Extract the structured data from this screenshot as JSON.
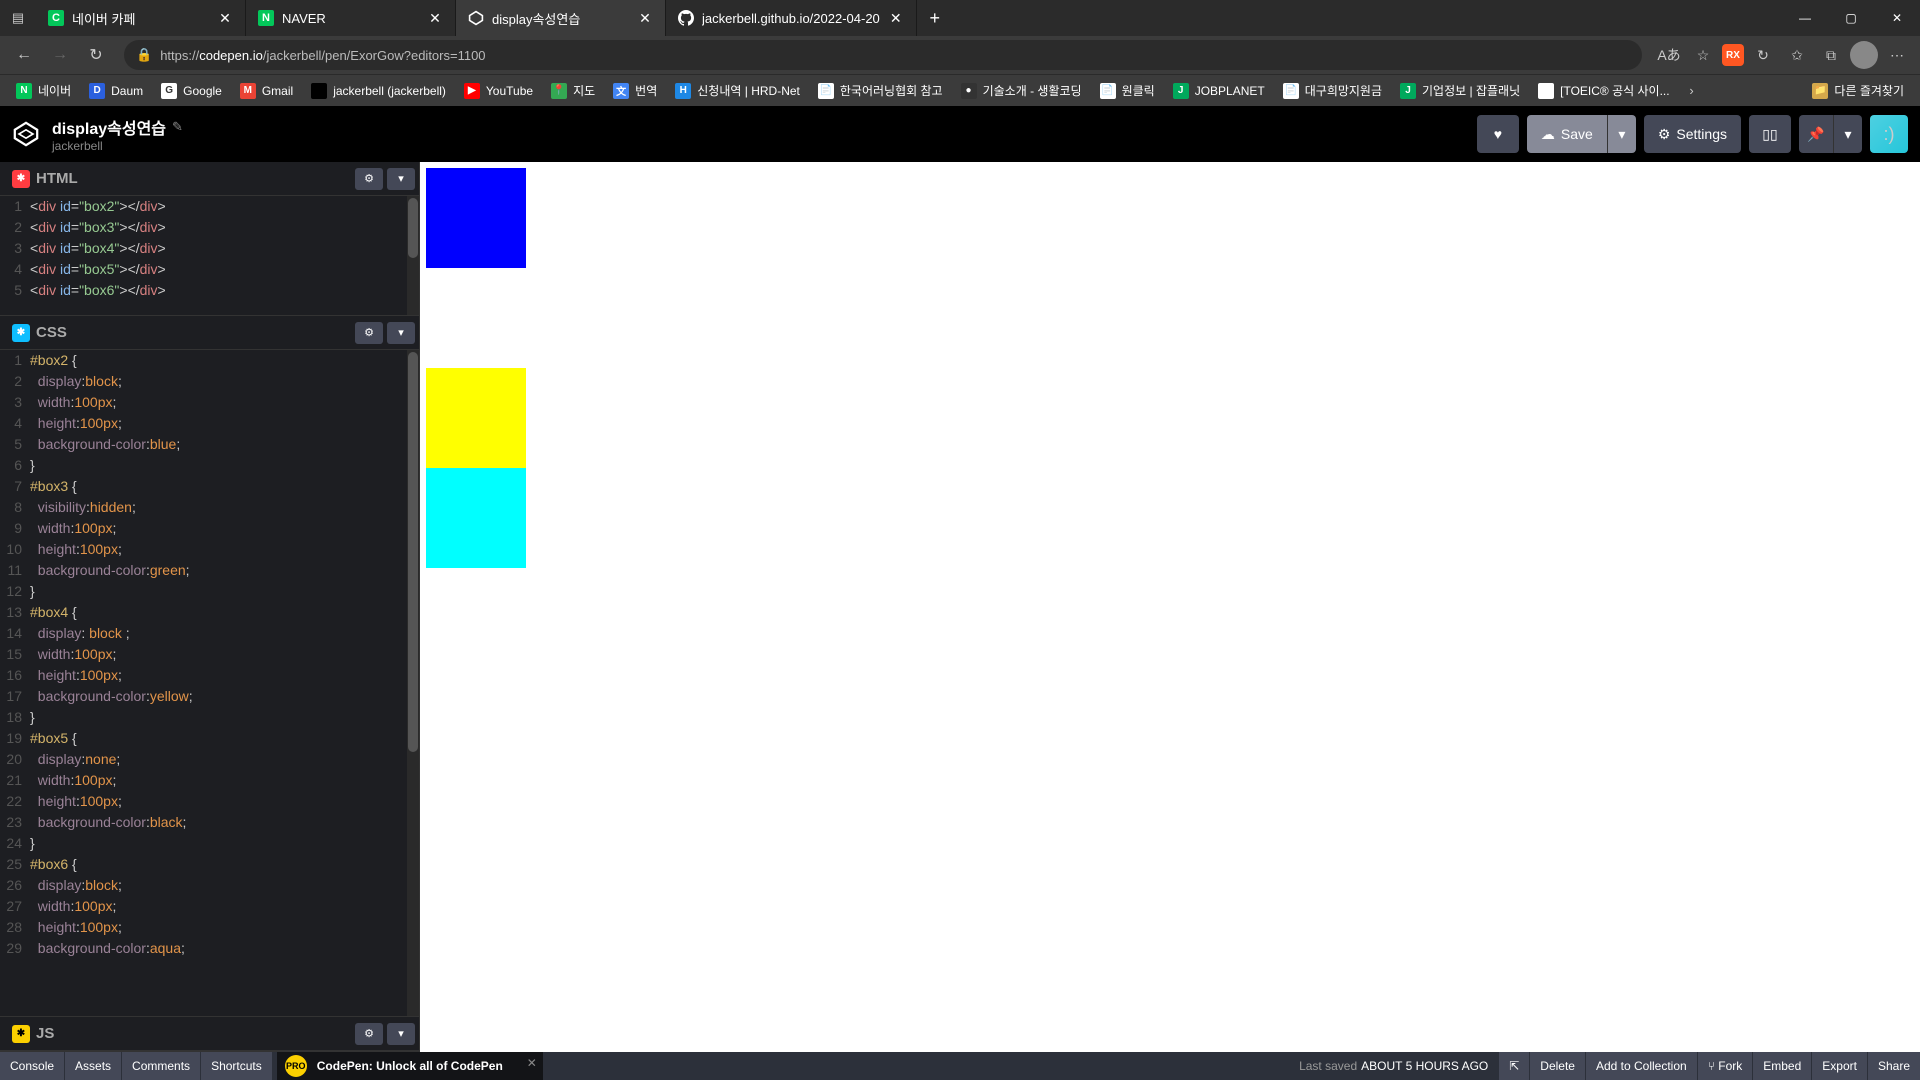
{
  "browser": {
    "tabs": [
      {
        "title": "네이버 카페",
        "favicon_bg": "#03c75a",
        "favicon_text": "C",
        "active": false,
        "close": true
      },
      {
        "title": "NAVER",
        "favicon_bg": "#03c75a",
        "favicon_text": "N",
        "active": false,
        "close": true
      },
      {
        "title": "display속성연습",
        "favicon_bg": "#000",
        "favicon_text": "",
        "active": true,
        "close": true,
        "codepen": true
      },
      {
        "title": "jackerbell.github.io/2022-04-20",
        "favicon_bg": "#000",
        "favicon_text": "",
        "active": false,
        "close": true,
        "github": true
      }
    ],
    "url_prefix": "https://",
    "url_domain": "codepen.io",
    "url_path": "/jackerbell/pen/ExorGow?editors=1100",
    "window_min": "—",
    "window_max": "▢",
    "window_close": "✕",
    "new_tab": "+"
  },
  "toolbar": {
    "back": "←",
    "forward": "→",
    "refresh": "↻",
    "lock": "🔒",
    "read_aloud": "Aあ",
    "star": "☆",
    "ext_label": "RX",
    "sync": "↻",
    "fav2": "✩",
    "collections": "⧉",
    "menu": "⋯"
  },
  "bookmarks": [
    {
      "label": "네이버",
      "bg": "#03c75a",
      "t": "N"
    },
    {
      "label": "Daum",
      "bg": "#2b60de",
      "t": "D"
    },
    {
      "label": "Google",
      "bg": "#fff",
      "t": "G"
    },
    {
      "label": "Gmail",
      "bg": "#ea4335",
      "t": "M"
    },
    {
      "label": "jackerbell (jackerbell)",
      "bg": "#000",
      "t": ""
    },
    {
      "label": "YouTube",
      "bg": "#ff0000",
      "t": "▶"
    },
    {
      "label": "지도",
      "bg": "#34a853",
      "t": "📍"
    },
    {
      "label": "번역",
      "bg": "#4285f4",
      "t": "文"
    },
    {
      "label": "신청내역 | HRD-Net",
      "bg": "#1e88e5",
      "t": "H"
    },
    {
      "label": "한국어러닝협회 참고",
      "bg": "#fff",
      "t": "📄"
    },
    {
      "label": "기술소개 - 생활코딩",
      "bg": "#333",
      "t": "●"
    },
    {
      "label": "원클릭",
      "bg": "#fff",
      "t": "📄"
    },
    {
      "label": "JOBPLANET",
      "bg": "#00a95c",
      "t": "J"
    },
    {
      "label": "대구희망지원금",
      "bg": "#fff",
      "t": "📄"
    },
    {
      "label": "기업정보 | 잡플래닛",
      "bg": "#00a95c",
      "t": "J"
    },
    {
      "label": "[TOEIC® 공식 사이...",
      "bg": "#fff",
      "t": ""
    }
  ],
  "bookmarks_overflow": "›",
  "bookmarks_right": "다른 즐겨찾기",
  "codepen": {
    "title": "display속성연습",
    "edit_icon": "✎",
    "author": "jackerbell",
    "heart": "♥",
    "save_label": "Save",
    "save_icon": "☁",
    "settings_label": "Settings",
    "settings_icon": "⚙",
    "layout_icon": "▯▯",
    "pin_icon": "📌",
    "chevron": "▾",
    "avatar_face": ":)",
    "editors": {
      "html_label": "HTML",
      "css_label": "CSS",
      "js_label": "JS",
      "gear": "⚙",
      "caret": "▾"
    },
    "html_code": {
      "lines": [
        "1",
        "2",
        "3",
        "4",
        "5"
      ],
      "content": [
        {
          "tag": "div",
          "id": "box2"
        },
        {
          "tag": "div",
          "id": "box3"
        },
        {
          "tag": "div",
          "id": "box4"
        },
        {
          "tag": "div",
          "id": "box5"
        },
        {
          "tag": "div",
          "id": "box6"
        }
      ]
    },
    "css_lines": [
      "1",
      "2",
      "3",
      "4",
      "5",
      "6",
      "7",
      "8",
      "9",
      "10",
      "11",
      "12",
      "13",
      "14",
      "15",
      "16",
      "17",
      "18",
      "19",
      "20",
      "21",
      "22",
      "23",
      "24",
      "25",
      "26",
      "27",
      "28",
      "29"
    ],
    "css_code": [
      {
        "type": "sel",
        "text": "#box2 {"
      },
      {
        "type": "decl",
        "prop": "display",
        "colon": ":",
        "val": "block",
        "semi": ";"
      },
      {
        "type": "decl",
        "prop": "width",
        "colon": ":",
        "val": "100px",
        "semi": ";"
      },
      {
        "type": "decl",
        "prop": "height",
        "colon": ":",
        "val": "100px",
        "semi": ";"
      },
      {
        "type": "decl",
        "prop": "background-color",
        "colon": ":",
        "val": "blue",
        "semi": ";"
      },
      {
        "type": "close",
        "text": "}"
      },
      {
        "type": "sel",
        "text": "#box3 {"
      },
      {
        "type": "decl",
        "prop": "visibility",
        "colon": ":",
        "val": "hidden",
        "semi": ";"
      },
      {
        "type": "decl",
        "prop": "width",
        "colon": ":",
        "val": "100px",
        "semi": ";"
      },
      {
        "type": "decl",
        "prop": "height",
        "colon": ":",
        "val": "100px",
        "semi": ";"
      },
      {
        "type": "decl",
        "prop": "background-color",
        "colon": ":",
        "val": "green",
        "semi": ";"
      },
      {
        "type": "close",
        "text": "}"
      },
      {
        "type": "sel",
        "text": "#box4 {"
      },
      {
        "type": "decl",
        "prop": "display",
        "colon": ": ",
        "val": "block ",
        "semi": ";"
      },
      {
        "type": "decl",
        "prop": "width",
        "colon": ":",
        "val": "100px",
        "semi": ";"
      },
      {
        "type": "decl",
        "prop": "height",
        "colon": ":",
        "val": "100px",
        "semi": ";"
      },
      {
        "type": "decl",
        "prop": "background-color",
        "colon": ":",
        "val": "yellow",
        "semi": ";"
      },
      {
        "type": "close",
        "text": "}"
      },
      {
        "type": "sel",
        "text": "#box5 {"
      },
      {
        "type": "decl",
        "prop": "display",
        "colon": ":",
        "val": "none",
        "semi": ";"
      },
      {
        "type": "decl",
        "prop": "width",
        "colon": ":",
        "val": "100px",
        "semi": ";"
      },
      {
        "type": "decl",
        "prop": "height",
        "colon": ":",
        "val": "100px",
        "semi": ";"
      },
      {
        "type": "decl",
        "prop": "background-color",
        "colon": ":",
        "val": "black",
        "semi": ";"
      },
      {
        "type": "close",
        "text": "}"
      },
      {
        "type": "sel",
        "text": "#box6 {"
      },
      {
        "type": "decl",
        "prop": "display",
        "colon": ":",
        "val": "block",
        "semi": ";"
      },
      {
        "type": "decl",
        "prop": "width",
        "colon": ":",
        "val": "100px",
        "semi": ";"
      },
      {
        "type": "decl",
        "prop": "height",
        "colon": ":",
        "val": "100px",
        "semi": ";"
      },
      {
        "type": "decl-partial",
        "prop": "background-color",
        "colon": ":",
        "val": "aqua",
        "semi": ";"
      }
    ],
    "footer": {
      "console": "Console",
      "assets": "Assets",
      "comments": "Comments",
      "shortcuts": "Shortcuts",
      "promo": "CodePen: Unlock all of CodePen",
      "promo_badge": "PRO",
      "promo_close": "✕",
      "saved_prefix": "Last saved ",
      "saved_time": "ABOUT 5 HOURS AGO",
      "open_icon": "⇱",
      "delete": "Delete",
      "add_collection": "Add to Collection",
      "fork_icon": "⑂",
      "fork": "Fork",
      "embed": "Embed",
      "export": "Export",
      "share": "Share"
    }
  }
}
